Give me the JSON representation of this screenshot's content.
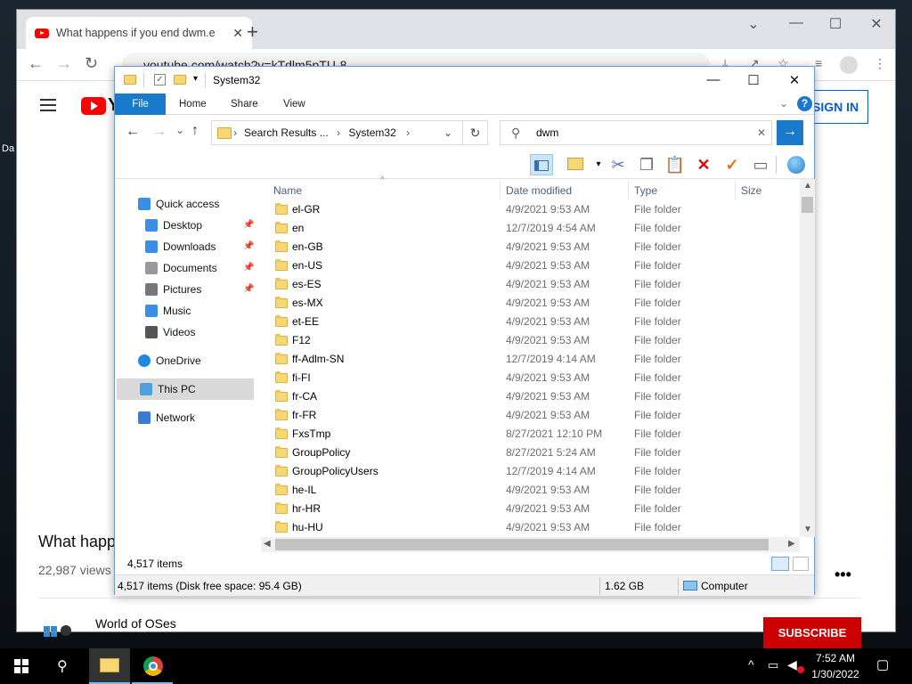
{
  "desktop": {
    "partial_icon_label": "Da"
  },
  "chrome": {
    "tab_title": "What happens if you end dwm.e",
    "close_tab": "✕",
    "new_tab": "+",
    "url": "youtube.com/watch?v=kTdlm5pTU-8",
    "window_buttons": {
      "dropdown": "⌄",
      "minimize": "—",
      "maximize": "☐",
      "close": "✕"
    },
    "nav": {
      "back": "←",
      "forward": "→",
      "reload": "↻"
    }
  },
  "youtube": {
    "logo_text": "Y",
    "sign_in": "SIGN IN",
    "video_title": "What happ",
    "views": "22,987 views •",
    "more": "•••",
    "channel": "World of OSes",
    "subscribe": "SUBSCRIBE"
  },
  "explorer": {
    "title": "System32",
    "window_buttons": {
      "minimize": "—",
      "maximize": "☐",
      "close": "✕"
    },
    "ribbon_tabs": [
      "File",
      "Home",
      "Share",
      "View"
    ],
    "help": "?",
    "address": {
      "back": "←",
      "forward": "→",
      "recent": "⌄",
      "up": "↑",
      "seg1": "Search Results ...",
      "seg2": "System32",
      "refresh": "↻"
    },
    "search": {
      "value": "dwm",
      "clear": "✕",
      "go": "→"
    },
    "nav_pane": [
      {
        "label": "Quick access",
        "icon": "star-icon",
        "indent": 0,
        "group": 0
      },
      {
        "label": "Desktop",
        "icon": "desktop-icon",
        "indent": 1,
        "group": 0,
        "pinned": true
      },
      {
        "label": "Downloads",
        "icon": "download-icon",
        "indent": 1,
        "group": 0,
        "pinned": true
      },
      {
        "label": "Documents",
        "icon": "document-icon",
        "indent": 1,
        "group": 0,
        "pinned": true
      },
      {
        "label": "Pictures",
        "icon": "picture-icon",
        "indent": 1,
        "group": 0,
        "pinned": true
      },
      {
        "label": "Music",
        "icon": "music-icon",
        "indent": 1,
        "group": 0
      },
      {
        "label": "Videos",
        "icon": "video-icon",
        "indent": 1,
        "group": 0
      },
      {
        "label": "OneDrive",
        "icon": "cloud-icon",
        "indent": 0,
        "group": 1
      },
      {
        "label": "This PC",
        "icon": "computer-icon",
        "indent": 0,
        "group": 2,
        "selected": true
      },
      {
        "label": "Network",
        "icon": "network-icon",
        "indent": 0,
        "group": 3
      }
    ],
    "columns": [
      "Name",
      "Date modified",
      "Type",
      "Size"
    ],
    "rows": [
      {
        "name": "el-GR",
        "date": "4/9/2021 9:53 AM",
        "type": "File folder"
      },
      {
        "name": "en",
        "date": "12/7/2019 4:54 AM",
        "type": "File folder"
      },
      {
        "name": "en-GB",
        "date": "4/9/2021 9:53 AM",
        "type": "File folder"
      },
      {
        "name": "en-US",
        "date": "4/9/2021 9:53 AM",
        "type": "File folder"
      },
      {
        "name": "es-ES",
        "date": "4/9/2021 9:53 AM",
        "type": "File folder"
      },
      {
        "name": "es-MX",
        "date": "4/9/2021 9:53 AM",
        "type": "File folder"
      },
      {
        "name": "et-EE",
        "date": "4/9/2021 9:53 AM",
        "type": "File folder"
      },
      {
        "name": "F12",
        "date": "4/9/2021 9:53 AM",
        "type": "File folder"
      },
      {
        "name": "ff-Adlm-SN",
        "date": "12/7/2019 4:14 AM",
        "type": "File folder"
      },
      {
        "name": "fi-FI",
        "date": "4/9/2021 9:53 AM",
        "type": "File folder"
      },
      {
        "name": "fr-CA",
        "date": "4/9/2021 9:53 AM",
        "type": "File folder"
      },
      {
        "name": "fr-FR",
        "date": "4/9/2021 9:53 AM",
        "type": "File folder"
      },
      {
        "name": "FxsTmp",
        "date": "8/27/2021 12:10 PM",
        "type": "File folder"
      },
      {
        "name": "GroupPolicy",
        "date": "8/27/2021 5:24 AM",
        "type": "File folder"
      },
      {
        "name": "GroupPolicyUsers",
        "date": "12/7/2019 4:14 AM",
        "type": "File folder"
      },
      {
        "name": "he-IL",
        "date": "4/9/2021 9:53 AM",
        "type": "File folder"
      },
      {
        "name": "hr-HR",
        "date": "4/9/2021 9:53 AM",
        "type": "File folder"
      },
      {
        "name": "hu-HU",
        "date": "4/9/2021 9:53 AM",
        "type": "File folder"
      }
    ],
    "status": {
      "item_count": "4,517 items",
      "detail": "4,517 items (Disk free space: 95.4 GB)",
      "size": "1.62 GB",
      "location": "Computer"
    }
  },
  "taskbar": {
    "time": "7:52 AM",
    "date": "1/30/2022"
  }
}
